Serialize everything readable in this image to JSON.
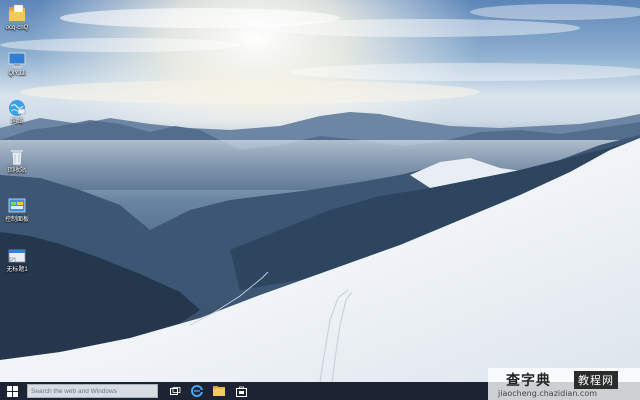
{
  "desktop_icons": [
    {
      "icon": "folder-icon",
      "label": "ocq·cnQ"
    },
    {
      "icon": "this-pc-icon",
      "label": "QlYJJi"
    },
    {
      "icon": "network-icon",
      "label": "网络"
    },
    {
      "icon": "recycle-bin-icon",
      "label": "回收站"
    },
    {
      "icon": "control-panel-icon",
      "label": "控制面板"
    },
    {
      "icon": "shortcut-icon",
      "label": "无标题1"
    }
  ],
  "taskbar": {
    "start_icon": "windows-logo-icon",
    "search_placeholder": "Search the web and Windows",
    "pinned": [
      {
        "icon": "task-view-icon"
      },
      {
        "icon": "edge-icon"
      },
      {
        "icon": "file-explorer-icon"
      },
      {
        "icon": "store-icon"
      }
    ]
  },
  "watermark": {
    "brand": "查字典",
    "section": "教程网",
    "url": "jiaocheng.chazidian.com"
  },
  "colors": {
    "taskbar_bg": "#1c2433",
    "accent_blue": "#2f7fd8"
  }
}
